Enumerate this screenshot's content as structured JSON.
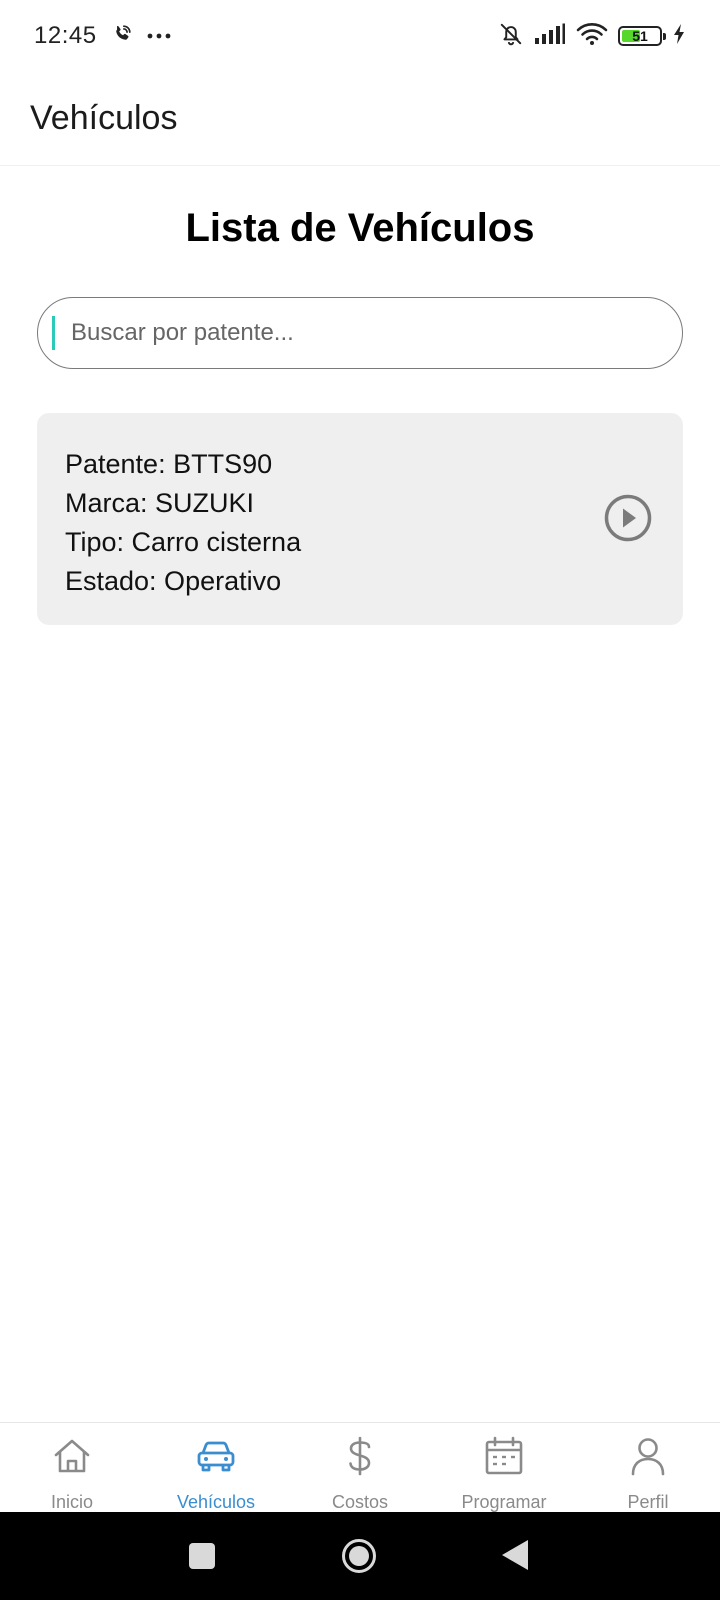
{
  "status_bar": {
    "time": "12:45",
    "battery_level": "51",
    "battery_percent": 51
  },
  "app_bar": {
    "title": "Vehículos"
  },
  "main": {
    "title": "Lista de Vehículos",
    "search": {
      "placeholder": "Buscar por patente...",
      "value": ""
    },
    "vehicles": [
      {
        "patente": "Patente: BTTS90",
        "marca": "Marca: SUZUKI",
        "tipo": "Tipo: Carro cisterna",
        "estado": "Estado: Operativo"
      }
    ]
  },
  "bottom_nav": {
    "items": [
      {
        "label": "Inicio",
        "icon": "home-icon",
        "active": false
      },
      {
        "label": "Vehículos",
        "icon": "car-icon",
        "active": true
      },
      {
        "label": "Costos",
        "icon": "dollar-icon",
        "active": false
      },
      {
        "label": "Programar",
        "icon": "calendar-icon",
        "active": false
      },
      {
        "label": "Perfil",
        "icon": "person-icon",
        "active": false
      }
    ]
  },
  "colors": {
    "accent": "#3a8ed0",
    "inactive": "#8a8a8a",
    "card_bg": "#efefef",
    "cursor": "#2bc9b8",
    "battery_fill": "#57d62c"
  }
}
